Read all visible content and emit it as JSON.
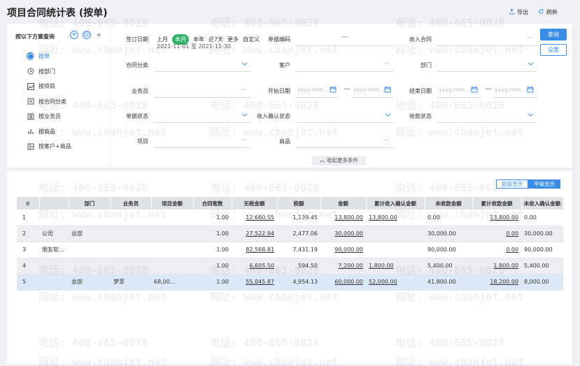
{
  "header": {
    "title": "项目合同统计表 (按单)",
    "export_label": "导出",
    "refresh_label": "刷新"
  },
  "scheme": {
    "title": "按以下方案查询",
    "items": [
      {
        "label": "按单",
        "icon": "cube-icon",
        "active": true
      },
      {
        "label": "按部门",
        "icon": "clock-icon",
        "active": false
      },
      {
        "label": "按项目",
        "icon": "chart-line-icon",
        "active": false
      },
      {
        "label": "按合同分类",
        "icon": "document-icon",
        "active": false
      },
      {
        "label": "按业务员",
        "icon": "person-card-icon",
        "active": false
      },
      {
        "label": "按商品",
        "icon": "bar-chart-icon",
        "active": false
      },
      {
        "label": "按客户+商品",
        "icon": "layout-icon",
        "active": false
      }
    ]
  },
  "filters": {
    "sign_date": {
      "label": "签订日期",
      "quick": [
        "上月",
        "本月",
        "本年",
        "近7天",
        "更多",
        "自定义"
      ],
      "selected": "本月",
      "range": "2021-11-01 至 2021-11-30"
    },
    "bill_code": {
      "label": "单据编码",
      "sep": "—"
    },
    "income_contract": {
      "label": "收入合同",
      "trail": "···"
    },
    "contract_category": {
      "label": "合同分类"
    },
    "customer": {
      "label": "客户",
      "trail": "···"
    },
    "department": {
      "label": "部门"
    },
    "salesperson": {
      "label": "业务员",
      "trail": "···"
    },
    "start_date": {
      "label": "开始日期",
      "placeholder_from": "yyyy-mm...",
      "placeholder_to": "yyyy-mm..."
    },
    "end_date": {
      "label": "结束日期",
      "placeholder_from": "yyyy-mm...",
      "placeholder_to": "yyyy-mm..."
    },
    "bill_status": {
      "label": "单据状态"
    },
    "income_confirm_status": {
      "label": "收入确认状态"
    },
    "collection_status": {
      "label": "收款状态"
    },
    "project": {
      "label": "项目",
      "trail": "···"
    },
    "goods": {
      "label": "商品",
      "trail": "···"
    },
    "query_label": "查询",
    "setting_label": "设置",
    "collapse_label": "收起更多条件"
  },
  "view_toggle": {
    "hier": "层级显示",
    "flat": "平级显示",
    "selected": "平级显示"
  },
  "table": {
    "columns": [
      "部门",
      "业务员",
      "项目金额",
      "合同笔数",
      "无税金额",
      "税额",
      "金额",
      "累计收入确认金额",
      "未收款金额",
      "累计收款金额",
      "未收入确认金额"
    ],
    "rows": [
      {
        "idx": "1",
        "name": "",
        "dept": "",
        "sales": "",
        "proj_amt": "",
        "count": "1.00",
        "notax": "12,660.55",
        "tax": "1,139.45",
        "amount": "13,800.00",
        "confirmed": "13,800.00",
        "unpaid": "0.00",
        "received": "13,800.00",
        "unconfirmed": "0.00"
      },
      {
        "idx": "2",
        "name": "公司",
        "dept": "总部",
        "sales": "",
        "proj_amt": "",
        "count": "1.00",
        "notax": "27,522.94",
        "tax": "2,477.06",
        "amount": "30,000.00",
        "confirmed": "",
        "unpaid": "30,000.00",
        "received": "0.00",
        "unconfirmed": "30,000.00"
      },
      {
        "idx": "3",
        "name": "朋友软...",
        "dept": "",
        "sales": "",
        "proj_amt": "",
        "count": "1.00",
        "notax": "82,568.81",
        "tax": "7,431.19",
        "amount": "90,000.00",
        "confirmed": "",
        "unpaid": "90,000.00",
        "received": "0.00",
        "unconfirmed": "90,000.00"
      },
      {
        "idx": "4",
        "name": "",
        "dept": "",
        "sales": "",
        "proj_amt": "",
        "count": "1.00",
        "notax": "6,605.50",
        "tax": "594.50",
        "amount": "7,200.00",
        "confirmed": "1,800.00",
        "unpaid": "5,400.00",
        "received": "1,800.00",
        "unconfirmed": "5,400.00"
      },
      {
        "idx": "5",
        "name": "",
        "dept": "总部",
        "sales": "梦菲",
        "proj_amt": "68,00...",
        "count": "1.00",
        "notax": "55,045.87",
        "tax": "4,954.13",
        "amount": "60,000.00",
        "confirmed": "52,000.00",
        "unpaid": "41,800.00",
        "received": "18,200.00",
        "unconfirmed": "8,000.00"
      }
    ]
  },
  "watermark": {
    "phone": "电话: 400-665-0028",
    "site": "网址: www.chanjet.net"
  },
  "colors": {
    "accent": "#3a8de6",
    "active_chip": "#2fb36b"
  }
}
